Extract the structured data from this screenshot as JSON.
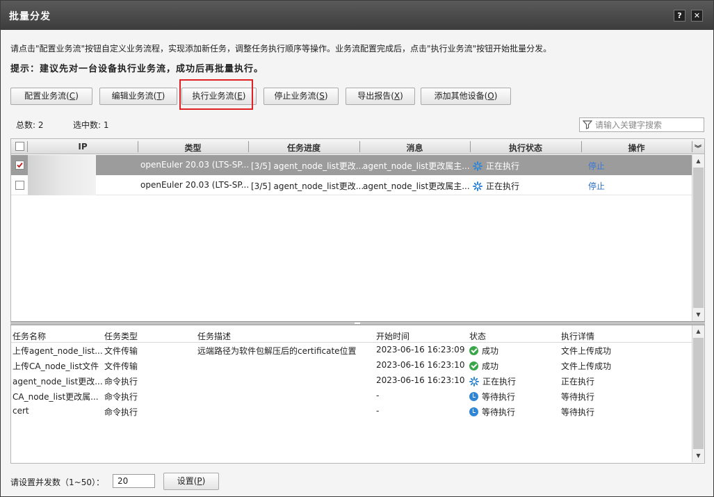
{
  "window": {
    "title": "批量分发",
    "help_icon": "?",
    "close_icon": "✕"
  },
  "intro": {
    "description": "请点击\"配置业务流\"按钮自定义业务流程，实现添加新任务，调整任务执行顺序等操作。业务流配置完成后，点击\"执行业务流\"按钮开始批量分发。",
    "tip": "提示：建议先对一台设备执行业务流，成功后再批量执行。"
  },
  "toolbar": {
    "buttons": [
      {
        "label": "配置业务流(",
        "key": "C",
        "suffix": ")"
      },
      {
        "label": "编辑业务流(",
        "key": "T",
        "suffix": ")"
      },
      {
        "label": "执行业务流(",
        "key": "E",
        "suffix": ")"
      },
      {
        "label": "停止业务流(",
        "key": "S",
        "suffix": ")"
      },
      {
        "label": "导出报告(",
        "key": "X",
        "suffix": ")"
      },
      {
        "label": "添加其他设备(",
        "key": "O",
        "suffix": ")"
      }
    ]
  },
  "summary": {
    "total": "总数: 2",
    "selected": "选中数: 1"
  },
  "search": {
    "placeholder": "请输入关键字搜索"
  },
  "device_table": {
    "columns": [
      "IP",
      "类型",
      "任务进度",
      "消息",
      "执行状态",
      "操作"
    ],
    "rows": [
      {
        "checked": true,
        "ip": "",
        "type": "openEuler 20.03 (LTS-SP...",
        "progress": "[3/5] agent_node_list更改...",
        "message": "agent_node_list更改属主...",
        "status": "正在执行",
        "action": "停止"
      },
      {
        "checked": false,
        "ip": "",
        "type": "openEuler 20.03 (LTS-SP...",
        "progress": "[3/5] agent_node_list更改...",
        "message": "agent_node_list更改属主...",
        "status": "正在执行",
        "action": "停止"
      }
    ]
  },
  "task_table": {
    "columns": [
      "任务名称",
      "任务类型",
      "任务描述",
      "开始时间",
      "状态",
      "执行详情"
    ],
    "rows": [
      {
        "name": "上传agent_node_list...",
        "type": "文件传输",
        "desc": "远端路径为软件包解压后的certificate位置",
        "start": "2023-06-16 16:23:09",
        "status": "成功",
        "status_kind": "ok",
        "detail": "文件上传成功"
      },
      {
        "name": "上传CA_node_list文件",
        "type": "文件传输",
        "desc": "",
        "start": "2023-06-16 16:23:10",
        "status": "成功",
        "status_kind": "ok",
        "detail": "文件上传成功"
      },
      {
        "name": "agent_node_list更改...",
        "type": "命令执行",
        "desc": "",
        "start": "2023-06-16 16:23:10",
        "status": "正在执行",
        "status_kind": "running",
        "detail": "正在执行"
      },
      {
        "name": "CA_node_list更改属...",
        "type": "命令执行",
        "desc": "",
        "start": "-",
        "status": "等待执行",
        "status_kind": "wait",
        "detail": "等待执行"
      },
      {
        "name": "cert",
        "type": "命令执行",
        "desc": "",
        "start": "-",
        "status": "等待执行",
        "status_kind": "wait",
        "detail": "等待执行"
      }
    ]
  },
  "footer": {
    "concurrency_label": "请设置并发数（1~50）：",
    "concurrency_value": "20",
    "set_button": {
      "label": "设置(",
      "key": "P",
      "suffix": ")"
    }
  }
}
